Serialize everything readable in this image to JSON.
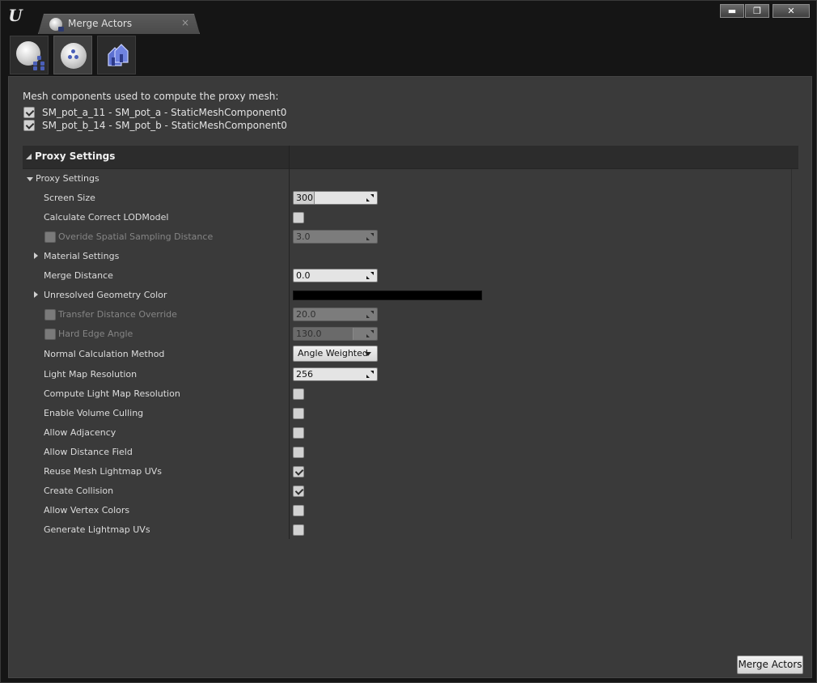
{
  "window": {
    "tab_title": "Merge Actors",
    "tab_close": "×",
    "buttons": {
      "minimize": "▬",
      "maximize": "❐",
      "close": "✕"
    }
  },
  "modes": [
    {
      "name": "merge-mode-icon",
      "active": false
    },
    {
      "name": "proxy-mode-icon",
      "active": true
    },
    {
      "name": "instance-mode-icon",
      "active": false
    }
  ],
  "mesh_components": {
    "header": "Mesh components used to compute the proxy mesh:",
    "items": [
      {
        "label": "SM_pot_a_11 - SM_pot_a - StaticMeshComponent0",
        "checked": true
      },
      {
        "label": "SM_pot_b_14 - SM_pot_b - StaticMeshComponent0",
        "checked": true
      }
    ]
  },
  "details": {
    "category": "Proxy Settings",
    "group": "Proxy Settings",
    "rows": {
      "screen_size": {
        "label": "Screen Size",
        "value": "300",
        "fill": 0.25
      },
      "calc_lod": {
        "label": "Calculate Correct LODModel",
        "checked": false
      },
      "spatial_sampling": {
        "label": "Overide Spatial Sampling Distance",
        "value": "3.0",
        "enabled": false
      },
      "material_settings": {
        "label": "Material Settings"
      },
      "merge_distance": {
        "label": "Merge Distance",
        "value": "0.0"
      },
      "unresolved_color": {
        "label": "Unresolved Geometry Color",
        "color": "#000000"
      },
      "transfer_distance": {
        "label": "Transfer Distance Override",
        "value": "20.0",
        "enabled": false
      },
      "hard_edge_angle": {
        "label": "Hard Edge Angle",
        "value": "130.0",
        "enabled": false,
        "fill": 0.72
      },
      "normal_method": {
        "label": "Normal Calculation Method",
        "value": "Angle Weighted"
      },
      "lightmap_resolution": {
        "label": "Light Map Resolution",
        "value": "256"
      },
      "compute_lightmap_res": {
        "label": "Compute Light Map Resolution",
        "checked": false
      },
      "volume_culling": {
        "label": "Enable Volume Culling",
        "checked": false
      },
      "allow_adjacency": {
        "label": "Allow Adjacency",
        "checked": false
      },
      "allow_distance_field": {
        "label": "Allow Distance Field",
        "checked": false
      },
      "reuse_lightmap_uvs": {
        "label": "Reuse Mesh Lightmap UVs",
        "checked": true
      },
      "create_collision": {
        "label": "Create Collision",
        "checked": true
      },
      "vertex_colors": {
        "label": "Allow Vertex Colors",
        "checked": false
      },
      "generate_lightmap_uvs": {
        "label": "Generate Lightmap UVs",
        "checked": false
      }
    }
  },
  "footer": {
    "merge_button": "Merge Actors"
  },
  "colors": {
    "panel": "#3a3a3a",
    "frame": "#151515",
    "accent": "#4a5fb8"
  }
}
